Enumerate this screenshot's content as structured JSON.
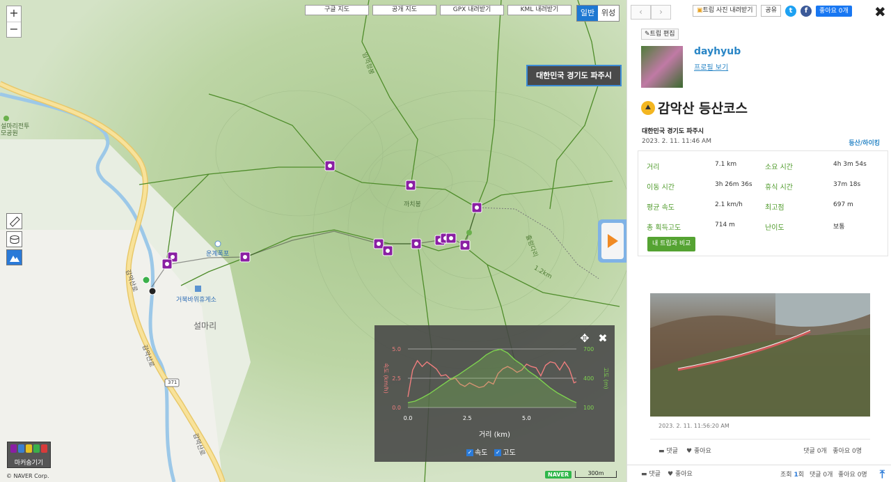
{
  "map": {
    "zoom_in": "+",
    "zoom_out": "−",
    "top_buttons": [
      "구글 지도",
      "공개 지도",
      "GPX 내려받기",
      "KML 내려받기"
    ],
    "map_types": [
      "일반",
      "위성"
    ],
    "active_map_type": "일반",
    "location_badge": "대한민국 경기도 파주시",
    "labels": {
      "memorial": "설마리전투\n모공원",
      "peak_kkachi": "까치봉",
      "waterfall": "운계폭포",
      "rest_area": "거북바위휴게소",
      "town": "설마리",
      "road1": "감악산로",
      "road2": "감악산로",
      "road3": "감악산로",
      "route_no": "371",
      "trail1": "임꺽정봉",
      "trail2": "1.2km",
      "trail3": "출렁다리"
    },
    "marker_legend_label": "마커숨기기",
    "copyright": "© NAVER Corp.",
    "naver_logo": "NAVER",
    "scale": "300m"
  },
  "chart_data": {
    "type": "line",
    "xlabel": "거리 (km)",
    "x_ticks": [
      "0.0",
      "2.5",
      "5.0"
    ],
    "xlim": [
      0,
      7.1
    ],
    "left_axis": {
      "label": "속도 (km/h)",
      "ticks": [
        "0.0",
        "2.5",
        "5.0"
      ],
      "range": [
        0,
        5
      ]
    },
    "right_axis": {
      "label": "고도 (m)",
      "ticks": [
        "100",
        "400",
        "700"
      ],
      "range": [
        100,
        700
      ]
    },
    "series": [
      {
        "name": "속도",
        "color": "#ef7e7e",
        "axis": "left",
        "x": [
          0,
          0.2,
          0.4,
          0.6,
          0.8,
          1.0,
          1.2,
          1.4,
          1.6,
          1.8,
          2.0,
          2.2,
          2.4,
          2.6,
          2.8,
          3.0,
          3.2,
          3.4,
          3.6,
          3.8,
          4.0,
          4.2,
          4.4,
          4.6,
          4.8,
          5.0,
          5.2,
          5.4,
          5.6,
          5.8,
          6.0,
          6.2,
          6.4,
          6.6,
          6.8,
          7.0,
          7.1
        ],
        "values": [
          0.9,
          3.2,
          4.0,
          3.5,
          3.9,
          3.6,
          3.3,
          2.7,
          2.8,
          2.4,
          2.5,
          2.0,
          1.8,
          2.1,
          1.9,
          1.7,
          1.8,
          2.2,
          2.0,
          2.9,
          3.3,
          3.5,
          3.3,
          3.0,
          3.2,
          3.7,
          3.5,
          3.4,
          2.7,
          3.6,
          3.9,
          3.8,
          3.2,
          3.9,
          3.3,
          2.1,
          2.2
        ]
      },
      {
        "name": "고도",
        "color": "#7ed24f",
        "axis": "right",
        "x": [
          0,
          0.3,
          0.6,
          0.9,
          1.2,
          1.5,
          1.8,
          2.1,
          2.4,
          2.7,
          3.0,
          3.3,
          3.6,
          3.9,
          4.2,
          4.5,
          4.8,
          5.1,
          5.4,
          5.7,
          6.0,
          6.3,
          6.6,
          6.9,
          7.1
        ],
        "values": [
          150,
          165,
          200,
          240,
          290,
          340,
          390,
          430,
          480,
          530,
          580,
          640,
          680,
          697,
          660,
          590,
          540,
          470,
          420,
          360,
          300,
          250,
          210,
          170,
          150
        ]
      }
    ],
    "grid": true,
    "legend": "bottom"
  },
  "chart": {
    "legend": [
      {
        "label": "속도",
        "checked": true
      },
      {
        "label": "고도",
        "checked": true
      }
    ]
  },
  "panel": {
    "nav_prev": "‹",
    "nav_next": "›",
    "download_photos": "트립 사진 내려받기",
    "share": "공유",
    "like_btn": "좋아요 0개",
    "edit": "트립 편집",
    "username": "dayhyub",
    "profile_link": "프로필 보기",
    "title": "감악산 등산코스",
    "region": "대한민국 경기도 파주시",
    "date": "2023. 2. 11. 11:46 AM",
    "category": "등산/하이킹",
    "stats": [
      {
        "k": "거리",
        "v": "7.1 km"
      },
      {
        "k": "소요 시간",
        "v": "4h 3m 54s"
      },
      {
        "k": "이동 시간",
        "v": "3h 26m 36s"
      },
      {
        "k": "휴식 시간",
        "v": "37m 18s"
      },
      {
        "k": "평균 속도",
        "v": "2.1 km/h"
      },
      {
        "k": "최고점",
        "v": "697 m"
      },
      {
        "k": "총 획득고도",
        "v": "714 m"
      },
      {
        "k": "난이도",
        "v": "보통"
      }
    ],
    "compare": "내 트립과 비교",
    "photo_date": "2023. 2. 11. 11:56:20 AM",
    "photo_comment": "댓글",
    "photo_like": "좋아요",
    "photo_counts": "댓글 0개   좋아요 0명",
    "footer_comment": "댓글",
    "footer_like": "좋아요",
    "footer_views_label": "조회",
    "footer_views": "1",
    "footer_views_unit": "회",
    "footer_comments": "댓글 0개",
    "footer_likes": "좋아요 0명"
  }
}
